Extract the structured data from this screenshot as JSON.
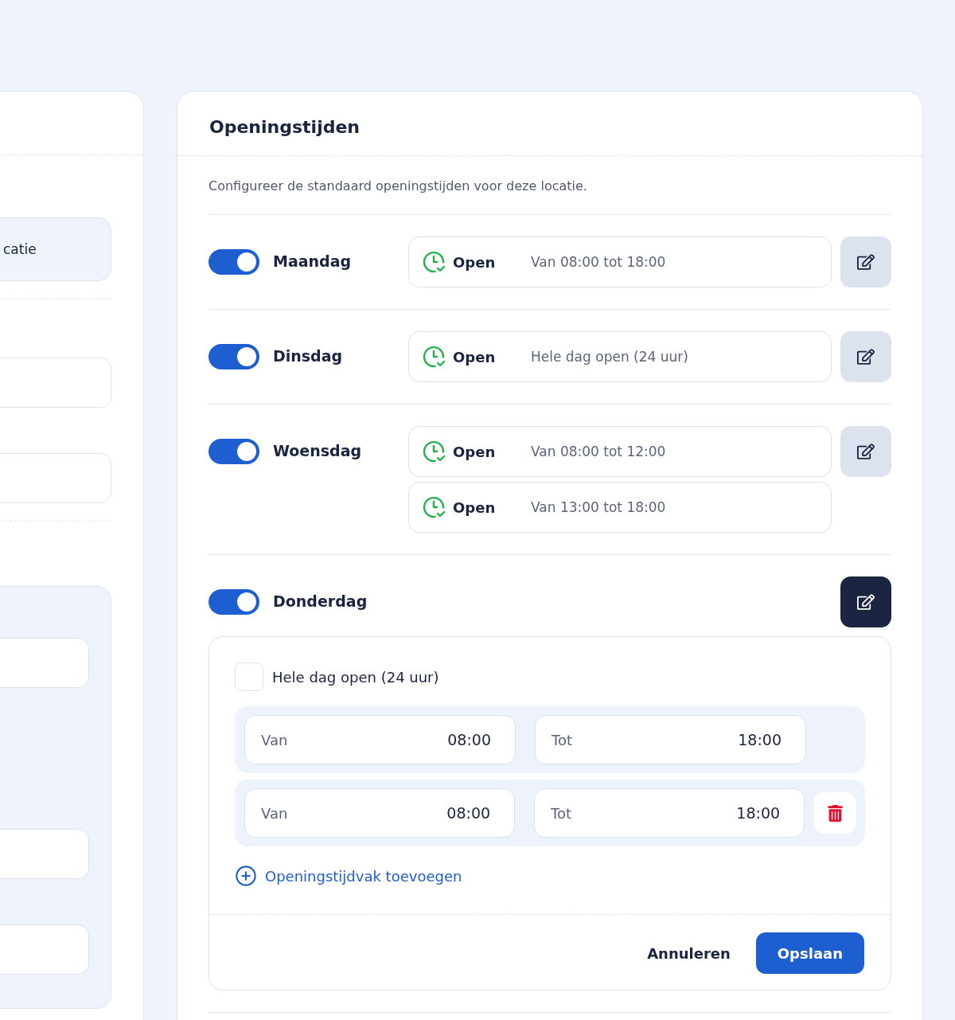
{
  "side_panel": {
    "item": "catie"
  },
  "hours_card": {
    "title": "Openingstijden",
    "description": "Configureer de standaard openingstijden voor deze locatie.",
    "days": [
      {
        "name": "Maandag",
        "enabled": true,
        "editing": false,
        "slots": [
          {
            "status": "Open",
            "hours": "Van 08:00 tot 18:00"
          }
        ]
      },
      {
        "name": "Dinsdag",
        "enabled": true,
        "editing": false,
        "slots": [
          {
            "status": "Open",
            "hours": "Hele dag open (24 uur)"
          }
        ]
      },
      {
        "name": "Woensdag",
        "enabled": true,
        "editing": false,
        "slots": [
          {
            "status": "Open",
            "hours": "Van 08:00 tot 12:00"
          },
          {
            "status": "Open",
            "hours": "Van 13:00 tot 18:00"
          }
        ]
      },
      {
        "name": "Donderdag",
        "enabled": true,
        "editing": true
      }
    ],
    "editor": {
      "all_day": {
        "label": "Hele dag open (24 uur)",
        "checked": false
      },
      "ranges": [
        {
          "from_label": "Van",
          "from": "08:00",
          "to_label": "Tot",
          "to": "18:00",
          "removable": false
        },
        {
          "from_label": "Van",
          "from": "08:00",
          "to_label": "Tot",
          "to": "18:00",
          "removable": true
        }
      ],
      "add_label": "Openingstijdvak toevoegen",
      "cancel": "Annuleren",
      "save": "Opslaan"
    }
  }
}
